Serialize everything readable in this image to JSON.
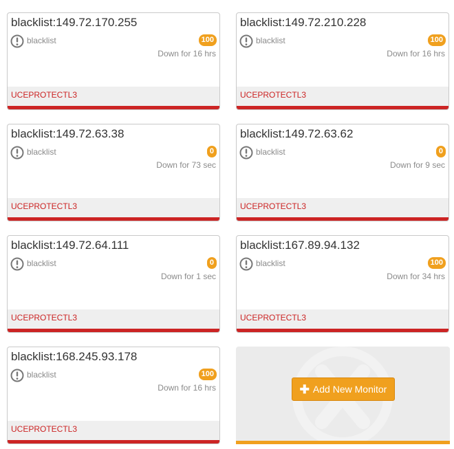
{
  "monitors": [
    {
      "name": "blacklist:149.72.170.255",
      "type": "blacklist",
      "badge": "100",
      "status": "Down for 16 hrs",
      "provider": "UCEPROTECTL3"
    },
    {
      "name": "blacklist:149.72.210.228",
      "type": "blacklist",
      "badge": "100",
      "status": "Down for 16 hrs",
      "provider": "UCEPROTECTL3"
    },
    {
      "name": "blacklist:149.72.63.38",
      "type": "blacklist",
      "badge": "0",
      "status": "Down for 73 sec",
      "provider": "UCEPROTECTL3"
    },
    {
      "name": "blacklist:149.72.63.62",
      "type": "blacklist",
      "badge": "0",
      "status": "Down for 9 sec",
      "provider": "UCEPROTECTL3"
    },
    {
      "name": "blacklist:149.72.64.111",
      "type": "blacklist",
      "badge": "0",
      "status": "Down for 1 sec",
      "provider": "UCEPROTECTL3"
    },
    {
      "name": "blacklist:167.89.94.132",
      "type": "blacklist",
      "badge": "100",
      "status": "Down for 34 hrs",
      "provider": "UCEPROTECTL3"
    },
    {
      "name": "blacklist:168.245.93.178",
      "type": "blacklist",
      "badge": "100",
      "status": "Down for 16 hrs",
      "provider": "UCEPROTECTL3"
    }
  ],
  "add_monitor": {
    "label": "Add New Monitor",
    "icon": "plus-icon"
  },
  "colors": {
    "accent": "#f0a01e",
    "down_red": "#cc2424",
    "footer_bg": "#efefef"
  }
}
